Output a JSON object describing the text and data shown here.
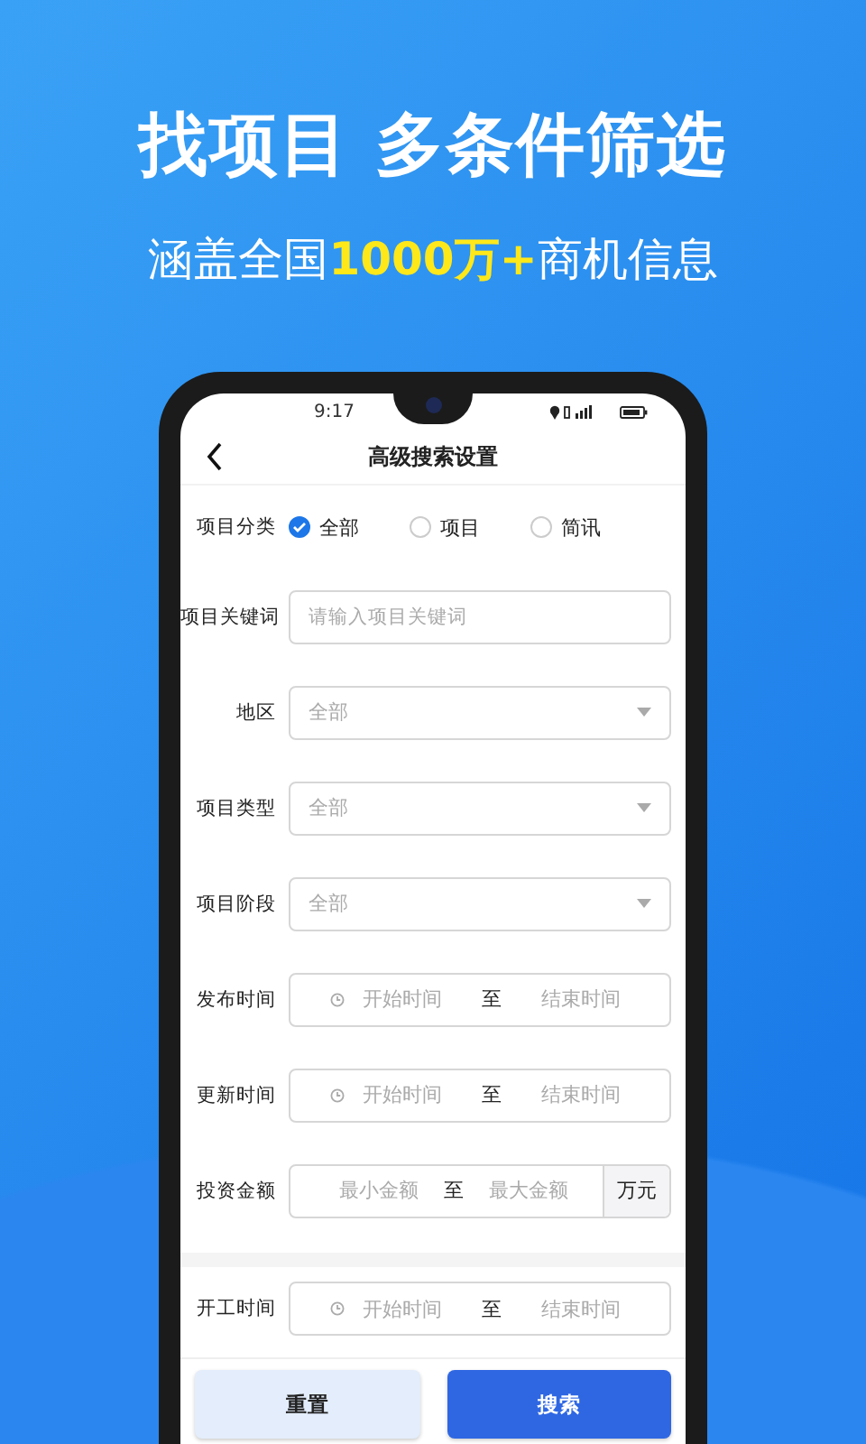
{
  "headline": "找项目 多条件筛选",
  "subheadline": {
    "before": "涵盖全国",
    "highlight": "1000万+",
    "after": "商机信息"
  },
  "status_bar": {
    "time": "9:17"
  },
  "nav": {
    "title": "高级搜索设置"
  },
  "sections": [
    {
      "fields": [
        {
          "kind": "radio",
          "label": "项目分类",
          "options": [
            {
              "label": "全部",
              "selected": true
            },
            {
              "label": "项目",
              "selected": false
            },
            {
              "label": "简讯",
              "selected": false
            }
          ]
        },
        {
          "kind": "text",
          "label": "项目关键词",
          "placeholder": "请输入项目关键词"
        },
        {
          "kind": "select",
          "label": "地区",
          "value": "全部"
        },
        {
          "kind": "select",
          "label": "项目类型",
          "value": "全部"
        },
        {
          "kind": "select",
          "label": "项目阶段",
          "value": "全部"
        },
        {
          "kind": "daterange",
          "label": "发布时间",
          "start": "开始时间",
          "separator": "至",
          "end": "结束时间"
        },
        {
          "kind": "daterange",
          "label": "更新时间",
          "start": "开始时间",
          "separator": "至",
          "end": "结束时间"
        },
        {
          "kind": "amount",
          "label": "投资金额",
          "start": "最小金额",
          "separator": "至",
          "end": "最大金额",
          "unit": "万元"
        }
      ]
    },
    {
      "fields": [
        {
          "kind": "daterange",
          "label": "开工时间",
          "start": "开始时间",
          "separator": "至",
          "end": "结束时间"
        }
      ]
    }
  ],
  "buttons": [
    {
      "label": "重置",
      "kind": "secondary"
    },
    {
      "label": "搜索",
      "kind": "primary"
    }
  ]
}
